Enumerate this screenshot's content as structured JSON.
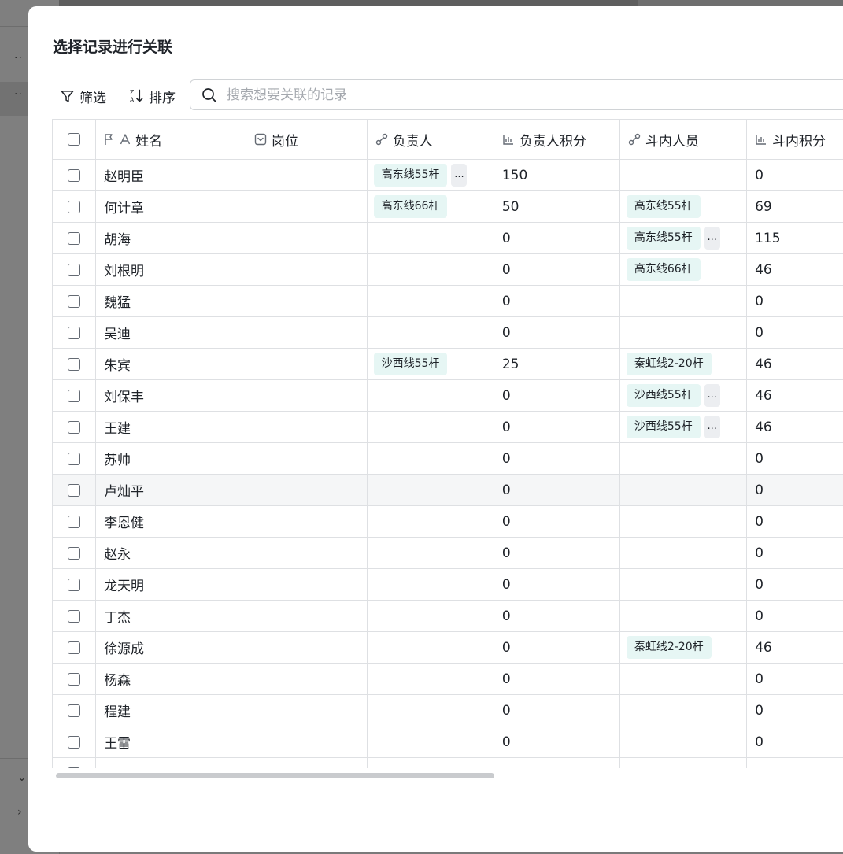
{
  "dialog": {
    "title": "选择记录进行关联",
    "filter_label": "筛选",
    "sort_label": "排序",
    "search_placeholder": "搜索想要关联的记录"
  },
  "background": {
    "dots": "··",
    "chevron_down": "⌄",
    "chevron_right": "›"
  },
  "columns": [
    {
      "label": "姓名",
      "icon": "primary-text-icon"
    },
    {
      "label": "岗位",
      "icon": "single-select-icon"
    },
    {
      "label": "负责人",
      "icon": "link-icon"
    },
    {
      "label": "负责人积分",
      "icon": "stats-icon"
    },
    {
      "label": "斗内人员",
      "icon": "link-icon"
    },
    {
      "label": "斗内积分",
      "icon": "stats-icon"
    }
  ],
  "rows": [
    {
      "name": "赵明臣",
      "position": "",
      "leader": "高东线55杆",
      "leader_more": "...",
      "leader_score": "150",
      "crew": "",
      "crew_more": "",
      "crew_score": "0"
    },
    {
      "name": "何计章",
      "position": "",
      "leader": "高东线66杆",
      "leader_more": "",
      "leader_score": "50",
      "crew": "高东线55杆",
      "crew_more": "",
      "crew_score": "69"
    },
    {
      "name": "胡海",
      "position": "",
      "leader": "",
      "leader_more": "",
      "leader_score": "0",
      "crew": "高东线55杆",
      "crew_more": "...",
      "crew_score": "115"
    },
    {
      "name": "刘根明",
      "position": "",
      "leader": "",
      "leader_more": "",
      "leader_score": "0",
      "crew": "高东线66杆",
      "crew_more": "",
      "crew_score": "46"
    },
    {
      "name": "魏猛",
      "position": "",
      "leader": "",
      "leader_more": "",
      "leader_score": "0",
      "crew": "",
      "crew_more": "",
      "crew_score": "0"
    },
    {
      "name": "吴迪",
      "position": "",
      "leader": "",
      "leader_more": "",
      "leader_score": "0",
      "crew": "",
      "crew_more": "",
      "crew_score": "0"
    },
    {
      "name": "朱宾",
      "position": "",
      "leader": "沙西线55杆",
      "leader_more": "",
      "leader_score": "25",
      "crew": "秦虹线2-20杆",
      "crew_more": "",
      "crew_score": "46"
    },
    {
      "name": "刘保丰",
      "position": "",
      "leader": "",
      "leader_more": "",
      "leader_score": "0",
      "crew": "沙西线55杆",
      "crew_more": "...",
      "crew_score": "46"
    },
    {
      "name": "王建",
      "position": "",
      "leader": "",
      "leader_more": "",
      "leader_score": "0",
      "crew": "沙西线55杆",
      "crew_more": "...",
      "crew_score": "46"
    },
    {
      "name": "苏帅",
      "position": "",
      "leader": "",
      "leader_more": "",
      "leader_score": "0",
      "crew": "",
      "crew_more": "",
      "crew_score": "0"
    },
    {
      "name": "卢灿平",
      "position": "",
      "leader": "",
      "leader_more": "",
      "leader_score": "0",
      "crew": "",
      "crew_more": "",
      "crew_score": "0"
    },
    {
      "name": "李恩健",
      "position": "",
      "leader": "",
      "leader_more": "",
      "leader_score": "0",
      "crew": "",
      "crew_more": "",
      "crew_score": "0"
    },
    {
      "name": "赵永",
      "position": "",
      "leader": "",
      "leader_more": "",
      "leader_score": "0",
      "crew": "",
      "crew_more": "",
      "crew_score": "0"
    },
    {
      "name": "龙天明",
      "position": "",
      "leader": "",
      "leader_more": "",
      "leader_score": "0",
      "crew": "",
      "crew_more": "",
      "crew_score": "0"
    },
    {
      "name": "丁杰",
      "position": "",
      "leader": "",
      "leader_more": "",
      "leader_score": "0",
      "crew": "",
      "crew_more": "",
      "crew_score": "0"
    },
    {
      "name": "徐源成",
      "position": "",
      "leader": "",
      "leader_more": "",
      "leader_score": "0",
      "crew": "秦虹线2-20杆",
      "crew_more": "",
      "crew_score": "46"
    },
    {
      "name": "杨森",
      "position": "",
      "leader": "",
      "leader_more": "",
      "leader_score": "0",
      "crew": "",
      "crew_more": "",
      "crew_score": "0"
    },
    {
      "name": "程建",
      "position": "",
      "leader": "",
      "leader_more": "",
      "leader_score": "0",
      "crew": "",
      "crew_more": "",
      "crew_score": "0"
    },
    {
      "name": "王雷",
      "position": "",
      "leader": "",
      "leader_more": "",
      "leader_score": "0",
      "crew": "",
      "crew_more": "",
      "crew_score": "0"
    }
  ],
  "colors": {
    "tag_bg": "#e6f6f4",
    "hover_row": "#f5f6f7",
    "border": "#dee0e3"
  }
}
